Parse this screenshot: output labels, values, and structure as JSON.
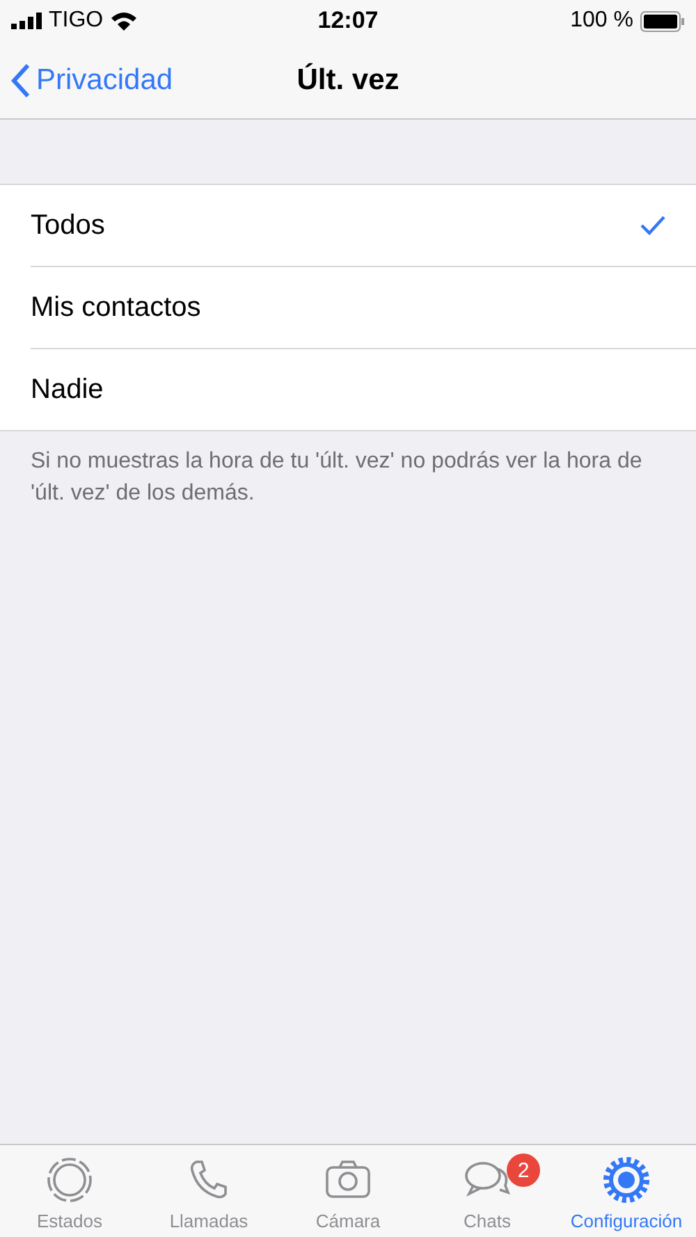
{
  "status_bar": {
    "carrier": "TIGO",
    "time": "12:07",
    "battery": "100 %"
  },
  "nav": {
    "back": "Privacidad",
    "title": "Últ. vez"
  },
  "options": [
    {
      "label": "Todos",
      "selected": true
    },
    {
      "label": "Mis contactos",
      "selected": false
    },
    {
      "label": "Nadie",
      "selected": false
    }
  ],
  "footer": "Si no muestras la hora de tu 'últ. vez' no podrás ver la hora de 'últ. vez' de los demás.",
  "tabs": [
    {
      "kind": "status",
      "label": "Estados",
      "selected": false
    },
    {
      "kind": "calls",
      "label": "Llamadas",
      "selected": false
    },
    {
      "kind": "camera",
      "label": "Cámara",
      "selected": false
    },
    {
      "kind": "chats",
      "label": "Chats",
      "selected": false,
      "badge": "2"
    },
    {
      "kind": "settings",
      "label": "Configuración",
      "selected": true
    }
  ]
}
